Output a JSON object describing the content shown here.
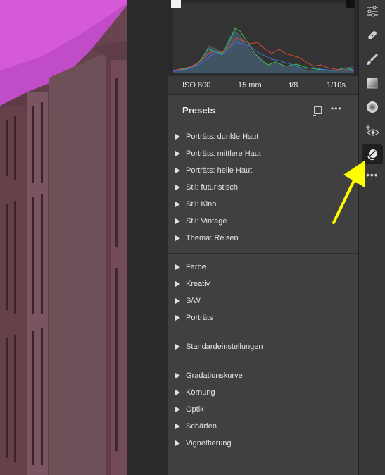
{
  "exif": {
    "iso": "ISO 800",
    "focal_length": "15 mm",
    "aperture": "f/8",
    "shutter": "1/10s"
  },
  "presets_panel": {
    "title": "Presets",
    "groups": [
      [
        "Porträts: dunkle Haut",
        "Porträts: mittlere Haut",
        "Porträts: helle Haut",
        "Stil: futuristisch",
        "Stil: Kino",
        "Stil: Vintage",
        "Thema: Reisen"
      ],
      [
        "Farbe",
        "Kreativ",
        "S/W",
        "Porträts"
      ],
      [
        "Standardeinstellungen"
      ],
      [
        "Gradationskurve",
        "Körnung",
        "Optik",
        "Schärfen",
        "Vignettierung"
      ]
    ]
  },
  "toolbar": {
    "tools": [
      "sliders-icon",
      "healing-icon",
      "brush-icon",
      "gradient-icon",
      "radial-icon",
      "redeye-icon",
      "presets-icon",
      "more-icon"
    ],
    "active": "presets-icon"
  },
  "colors": {
    "annotation_arrow": "#ffff00",
    "histogram_red": "#d94a3c",
    "histogram_green": "#3cc24a",
    "histogram_blue": "#3f6fd8"
  }
}
